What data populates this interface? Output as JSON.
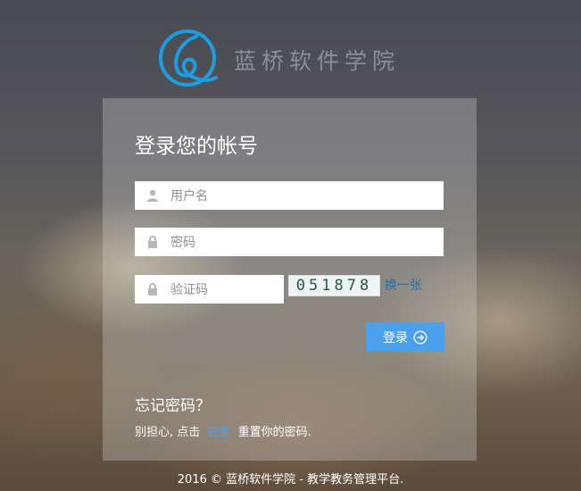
{
  "brand": {
    "name": "蓝桥软件学院",
    "logo_color": "#1c9ee3"
  },
  "login": {
    "title": "登录您的帐号",
    "username_placeholder": "用户名",
    "password_placeholder": "密码",
    "captcha_placeholder": "验证码",
    "captcha_code": "051878",
    "refresh_label": "换一张",
    "submit_label": "登录",
    "accent_color": "#4ba0ec"
  },
  "forgot": {
    "title": "忘记密码？",
    "hint_prefix": "别担心, 点击",
    "hint_link": "这里",
    "hint_suffix": "重置你的密码."
  },
  "footer": {
    "text": "2016 © 蓝桥软件学院 - 教学教务管理平台."
  }
}
